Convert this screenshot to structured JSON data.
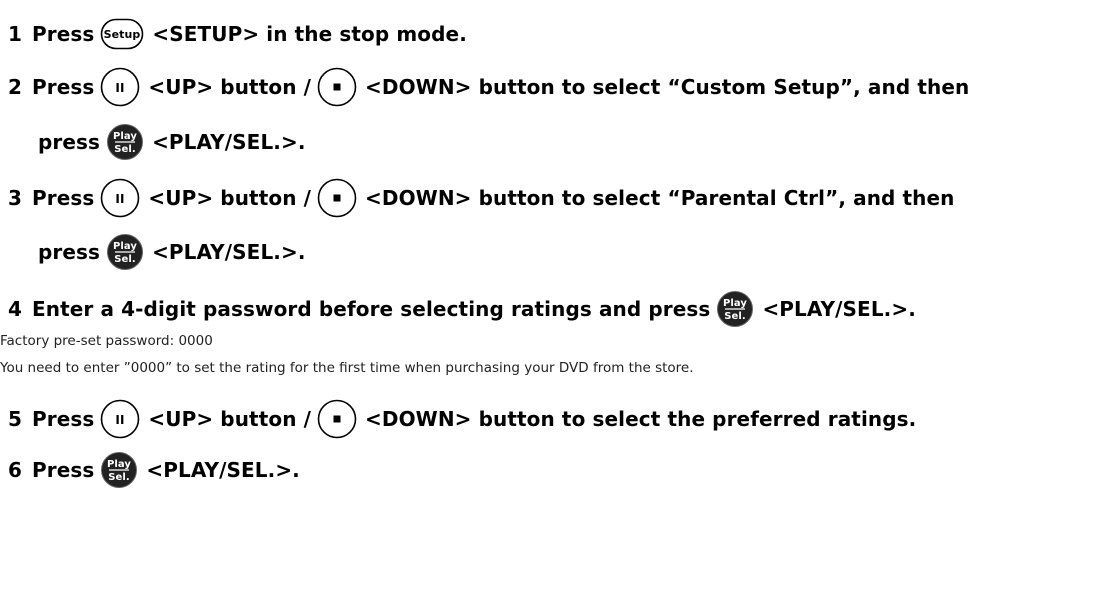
{
  "steps": [
    {
      "number": "1",
      "lead": "Press",
      "button": "Setup",
      "text": "<SETUP> in the stop mode."
    },
    {
      "number": "2",
      "lead": "Press",
      "up_text": "<UP> button /",
      "down_text": "<DOWN> button to select “Custom Setup”, and then"
    },
    {
      "continuation": "press",
      "text": "<PLAY/SEL.>."
    },
    {
      "number": "3",
      "lead": "Press",
      "up_text": "<UP> button /",
      "down_text": "<DOWN> button to select “Parental Ctrl”, and then"
    },
    {
      "continuation": "press",
      "text": "<PLAY/SEL.>."
    },
    {
      "number": "4",
      "lead": "Enter a 4-digit password before selecting ratings and press",
      "text": "<PLAY/SEL.>."
    },
    {
      "number": "5",
      "lead": "Press",
      "up_text": "<UP> button /",
      "down_text": "<DOWN> button to select the preferred ratings."
    },
    {
      "number": "6",
      "lead": "Press",
      "text": "<PLAY/SEL.>."
    }
  ],
  "notes": {
    "factory_password": "Factory pre-set password: 0000",
    "first_time": "You need to enter ”0000” to set the rating for the first time when purchasing your DVD from the store."
  },
  "icons": {
    "setup_label": "Setup",
    "play_top": "Play",
    "play_bottom": "Sel.",
    "up_glyph": "II",
    "down_glyph": "■"
  }
}
